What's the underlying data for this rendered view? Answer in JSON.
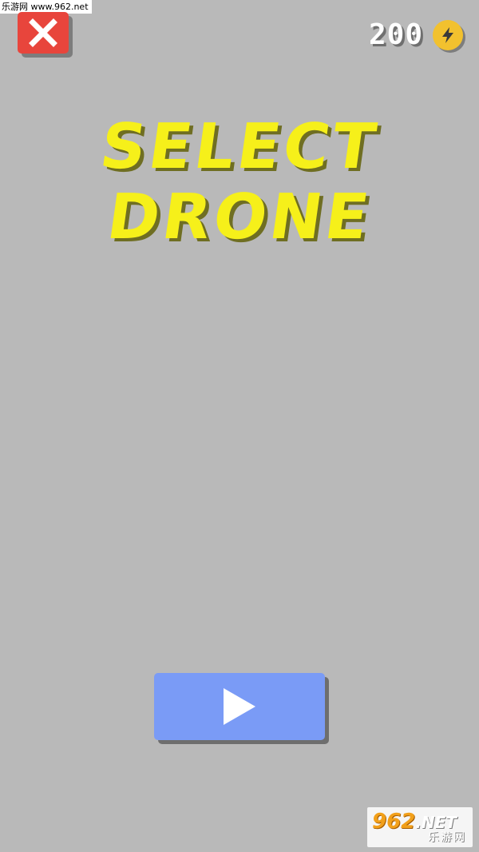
{
  "watermark": {
    "top_text": "乐游网 www.962.net",
    "bottom_logo_main": "962",
    "bottom_logo_suffix": ".NET",
    "bottom_logo_sub": "乐游网"
  },
  "header": {
    "close_icon": "close-x-icon",
    "currency_amount": "200",
    "currency_icon": "lightning-bolt-icon"
  },
  "title": {
    "line1": "SELECT",
    "line2": "DRONE"
  },
  "play_button": {
    "icon": "play-triangle-icon"
  },
  "colors": {
    "background": "#b9b9b9",
    "close_button": "#e8453c",
    "title_yellow": "#f6f01a",
    "play_button": "#7a9bf6",
    "coin": "#f2c12e"
  }
}
